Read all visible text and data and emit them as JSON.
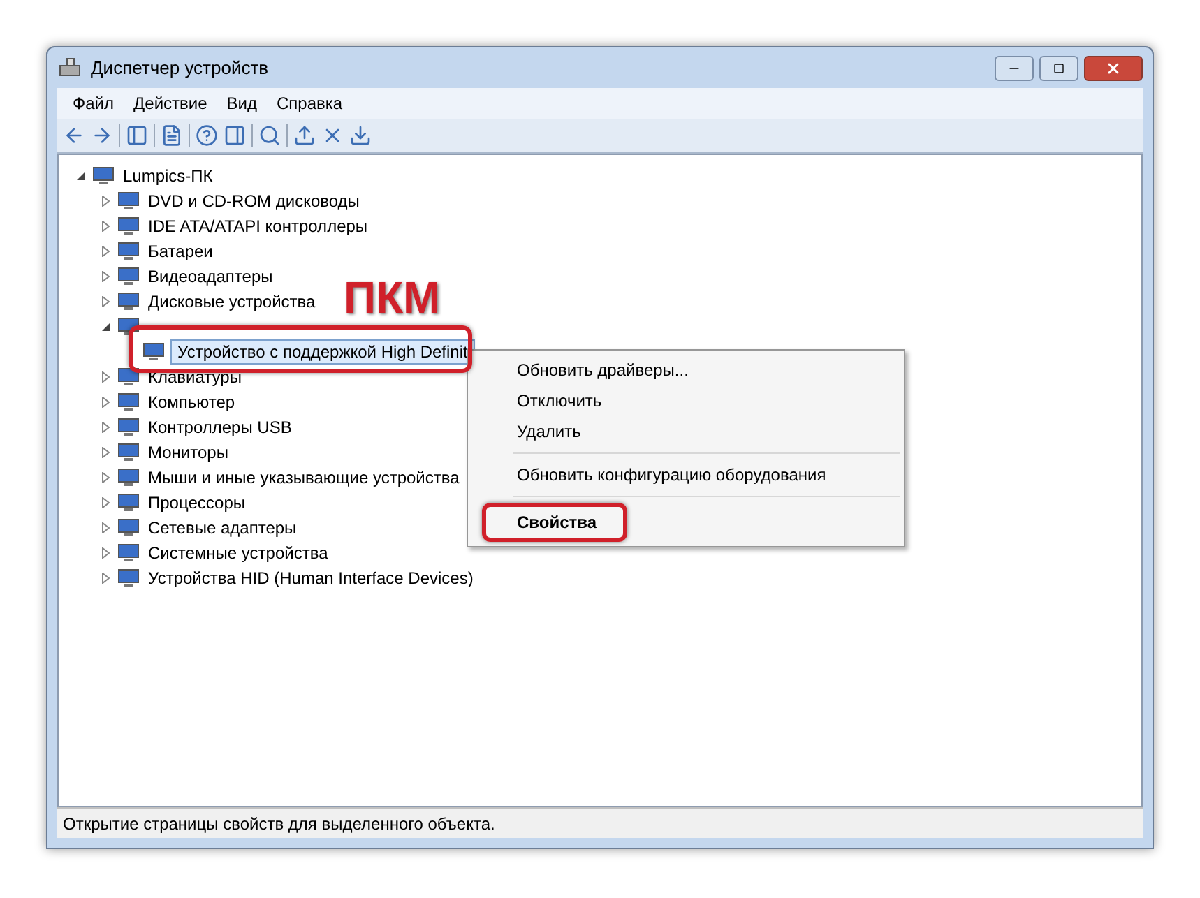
{
  "window": {
    "title": "Диспетчер устройств"
  },
  "menu": [
    "Файл",
    "Действие",
    "Вид",
    "Справка"
  ],
  "tree": {
    "label": "Lumpics-ПК",
    "expanded": true,
    "children": [
      {
        "label": "DVD и CD-ROM дисководы",
        "expanded": false
      },
      {
        "label": "IDE ATA/ATAPI контроллеры",
        "expanded": false
      },
      {
        "label": "Батареи",
        "expanded": false
      },
      {
        "label": "Видеоадаптеры",
        "expanded": false
      },
      {
        "label": "Дисковые устройства",
        "expanded": false
      },
      {
        "expanded": true,
        "children": [
          {
            "label": "Устройство с поддержкой High Definit",
            "selected": true
          }
        ]
      },
      {
        "label": "Клавиатуры",
        "expanded": false
      },
      {
        "label": "Компьютер",
        "expanded": false
      },
      {
        "label": "Контроллеры USB",
        "expanded": false
      },
      {
        "label": "Мониторы",
        "expanded": false
      },
      {
        "label": "Мыши и иные указывающие устройства",
        "expanded": false
      },
      {
        "label": "Процессоры",
        "expanded": false
      },
      {
        "label": "Сетевые адаптеры",
        "expanded": false
      },
      {
        "label": "Системные устройства",
        "expanded": false
      },
      {
        "label": "Устройства HID (Human Interface Devices)",
        "expanded": false
      }
    ]
  },
  "context_menu": [
    {
      "kind": "item",
      "label": "Обновить драйверы...",
      "default": false
    },
    {
      "kind": "item",
      "label": "Отключить",
      "default": false
    },
    {
      "kind": "item",
      "label": "Удалить",
      "default": false
    },
    {
      "kind": "separator"
    },
    {
      "kind": "item",
      "label": "Обновить конфигурацию оборудования",
      "default": false
    },
    {
      "kind": "separator"
    },
    {
      "kind": "item",
      "label": "Свойства",
      "default": true
    }
  ],
  "annotation": {
    "text": "ПКМ"
  },
  "status_bar": "Открытие страницы свойств для выделенного объекта."
}
